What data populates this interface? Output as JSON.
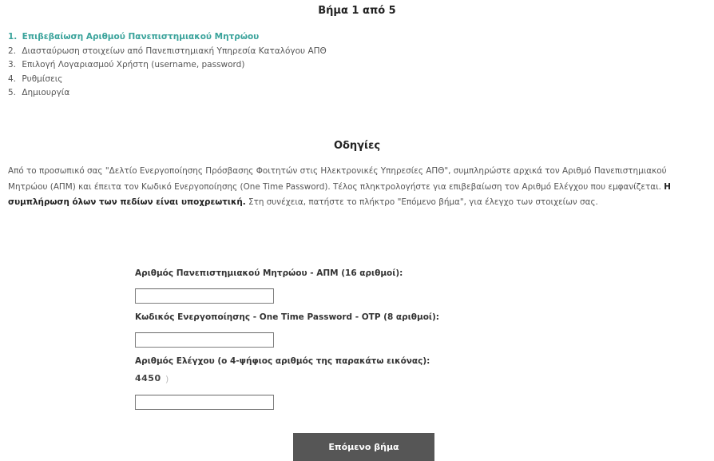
{
  "page": {
    "step_title": "Βήμα 1 από 5"
  },
  "steps": [
    {
      "num": "1.",
      "label": "Επιβεβαίωση Αριθμού Πανεπιστημιακού Μητρώου"
    },
    {
      "num": "2.",
      "label": "Διασταύρωση στοιχείων από Πανεπιστημιακή Υπηρεσία Καταλόγου ΑΠΘ"
    },
    {
      "num": "3.",
      "label": "Επιλογή Λογαριασμού Χρήστη (username, password)"
    },
    {
      "num": "4.",
      "label": "Ρυθμίσεις"
    },
    {
      "num": "5.",
      "label": "Δημιουργία"
    }
  ],
  "instructions": {
    "title": "Οδηγίες",
    "text_before": "Από το προσωπικό σας \"Δελτίο Ενεργοποίησης Πρόσβασης Φοιτητών στις Ηλεκτρονικές Υπηρεσίες ΑΠΘ\", συμπληρώστε αρχικά τον Αριθμό Πανεπιστημιακού Μητρώου (ΑΠΜ) και έπειτα τον Κωδικό Ενεργοποίησης (One Time Password). Τέλος πληκτρολογήστε για επιβεβαίωση τον Αριθμό Ελέγχου που εμφανίζεται.",
    "text_bold": "Η συμπλήρωση όλων των πεδίων είναι υποχρεωτική.",
    "text_after": "Στη συνέχεια, πατήστε το πλήκτρο \"Επόμενο βήμα\", για έλεγχο των στοιχείων σας."
  },
  "form": {
    "apm_label": "Αριθμός Πανεπιστημιακού Μητρώου - ΑΠΜ (16 αριθμοί):",
    "apm_value": "",
    "otp_label": "Κωδικός Ενεργοποίησης - One Time Password - OTP (8 αριθμοί):",
    "otp_value": "",
    "captcha_label": "Αριθμός Ελέγχου (ο 4-ψήφιος αριθμός της παρακάτω εικόνας):",
    "captcha_image_text": "4450",
    "captcha_value": "",
    "submit_label": "Επόμενο βήμα"
  },
  "colors": {
    "active_step": "#3aa39b",
    "button_bg": "#565656",
    "button_text": "#ffffff"
  }
}
